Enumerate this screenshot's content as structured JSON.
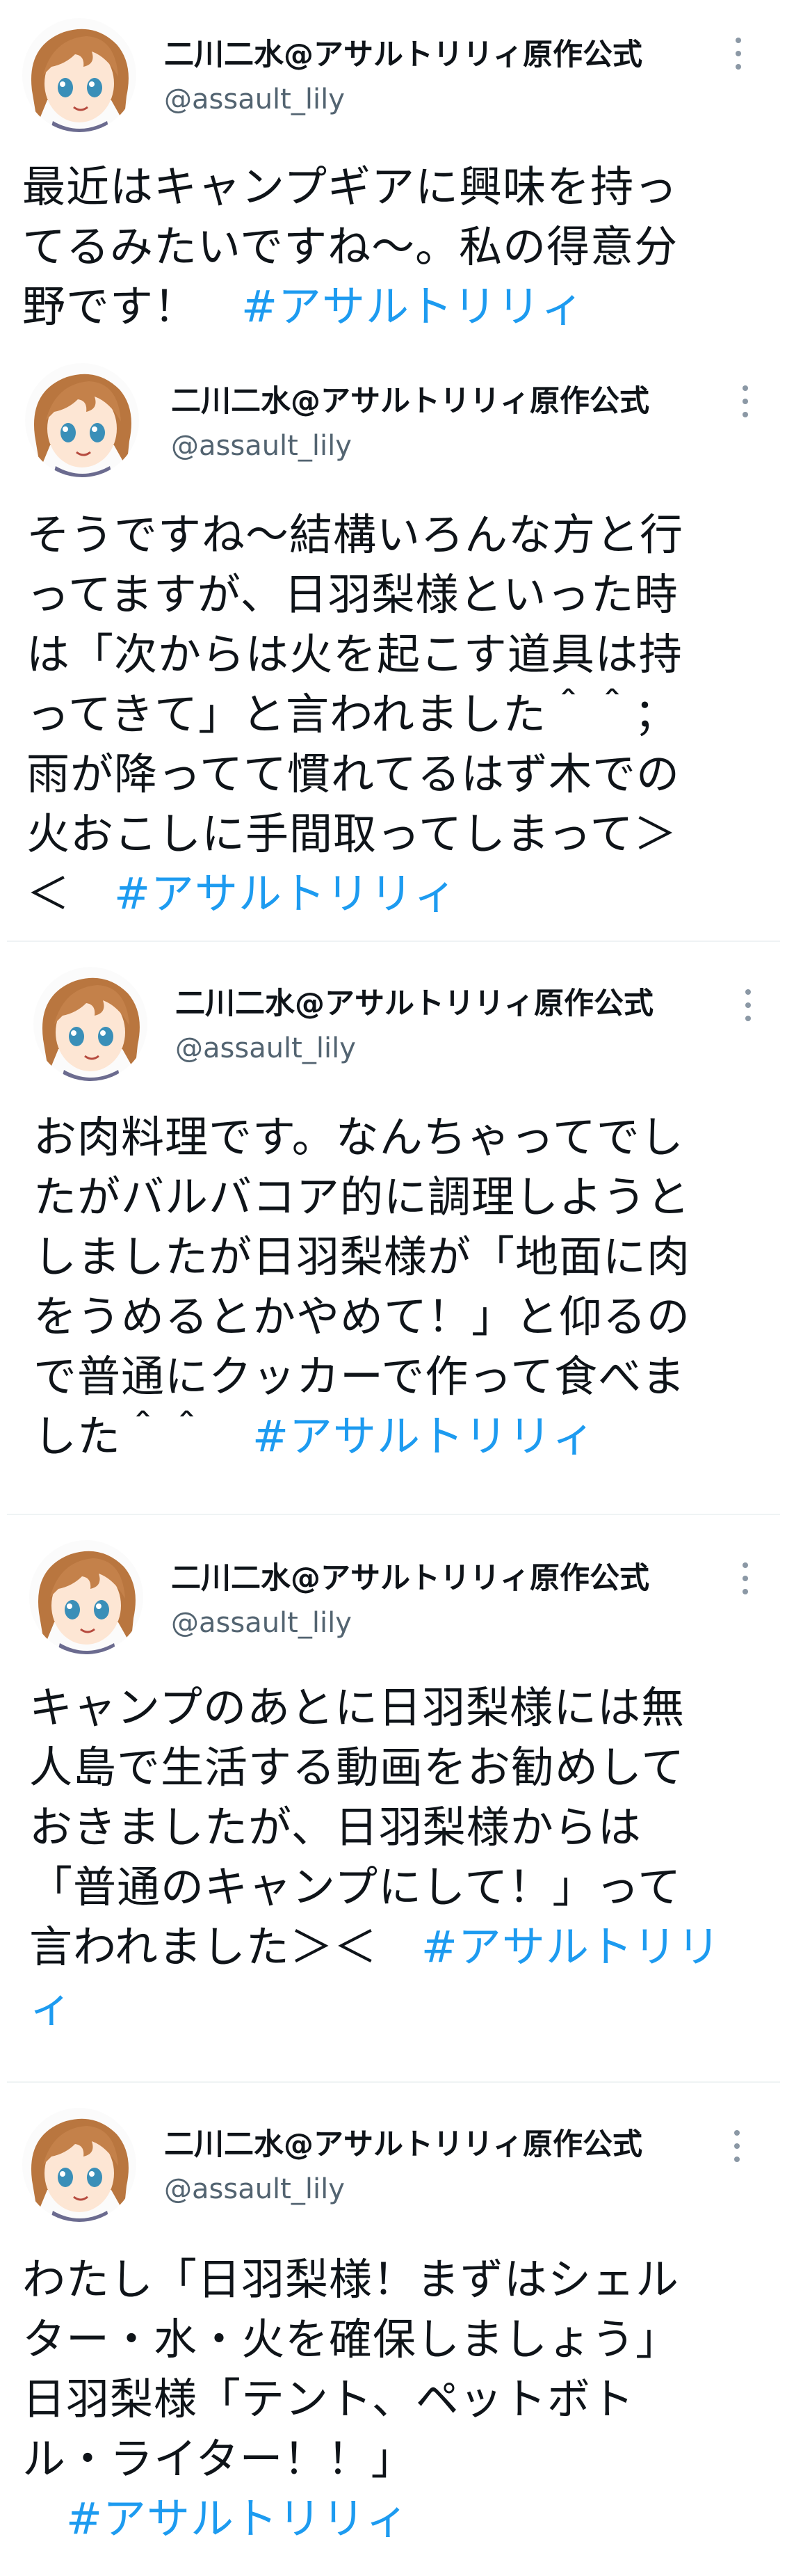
{
  "colors": {
    "hashtag": "#1d9bf0",
    "text": "#0f1419",
    "handle": "#536471",
    "separator": "#eff3f4"
  },
  "tweets": [
    {
      "name": "二川二水@アサルトリリィ原作公式",
      "handle": "@assault_lily",
      "body": "最近はキャンプギアに興味を持っ\nてるみたいですね〜。私の得意分\n野です！　",
      "hashtag": "#アサルトリリィ"
    },
    {
      "name": "二川二水@アサルトリリィ原作公式",
      "handle": "@assault_lily",
      "body": "そうですね〜結構いろんな方と行\nってますが、日羽梨様といった時\nは「次からは火を起こす道具は持\nってきて」と言われました＾＾；\n雨が降ってて慣れてるはず木での\n火おこしに手間取ってしまって＞\n＜　",
      "hashtag": "#アサルトリリィ"
    },
    {
      "name": "二川二水@アサルトリリィ原作公式",
      "handle": "@assault_lily",
      "body": "お肉料理です。なんちゃってでし\nたがバルバコア的に調理しようと\nしましたが日羽梨様が「地面に肉\nをうめるとかやめて！」と仰るの\nで普通にクッカーで作って食べま\nした＾＾　",
      "hashtag": "#アサルトリリィ"
    },
    {
      "name": "二川二水@アサルトリリィ原作公式",
      "handle": "@assault_lily",
      "body": "キャンプのあとに日羽梨様には無\n人島で生活する動画をお勧めして\nおきましたが、日羽梨様からは\n「普通のキャンプにして！」って\n言われました＞＜　",
      "hashtag": "#アサルトリリ\nィ"
    },
    {
      "name": "二川二水@アサルトリリィ原作公式",
      "handle": "@assault_lily",
      "body": "わたし「日羽梨様！まずはシェル\nター・水・火を確保しましょう」\n日羽梨様「テント、ペットボト\nル・ライター！！」\n　",
      "hashtag": "#アサルトリリィ"
    }
  ]
}
